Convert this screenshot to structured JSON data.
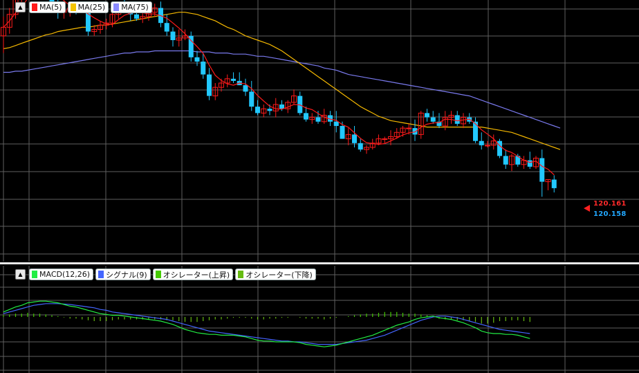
{
  "main_legend": {
    "collapse": "▲",
    "items": [
      {
        "label": "MA(5)",
        "color": "#ff1a1a"
      },
      {
        "label": "MA(25)",
        "color": "#f5c400"
      },
      {
        "label": "MA(75)",
        "color": "#8a8aff"
      }
    ]
  },
  "macd_legend": {
    "collapse": "▲",
    "items": [
      {
        "label": "MACD(12,26)",
        "color": "#22ee44"
      },
      {
        "label": "シグナル(9)",
        "color": "#4466ff"
      },
      {
        "label": "オシレーター(上昇)",
        "color": "#44cc00"
      },
      {
        "label": "オシレーター(下降)",
        "color": "#66bb11"
      }
    ]
  },
  "price_labels": {
    "current_red": "120.161",
    "current_blue": "120.158"
  },
  "chart_data": [
    {
      "type": "candlestick",
      "colors": {
        "up": "#ff1a1a",
        "down": "#22c8ff",
        "ma5": "#ff1a1a",
        "ma25": "#f5b800",
        "ma75": "#7a7aee",
        "grid": "#606060"
      },
      "candles": [
        [
          0.2,
          1.1,
          -0.6,
          0.6
        ],
        [
          0.6,
          1.5,
          0.3,
          1.2
        ],
        [
          1.2,
          2.2,
          1.0,
          2.0
        ],
        [
          2.0,
          3.0,
          1.6,
          2.4
        ],
        [
          2.4,
          3.9,
          2.2,
          3.5
        ],
        [
          3.5,
          3.7,
          2.6,
          2.9
        ],
        [
          2.9,
          3.2,
          2.3,
          2.7
        ],
        [
          2.7,
          2.9,
          1.9,
          2.2
        ],
        [
          2.2,
          2.5,
          1.3,
          1.6
        ],
        [
          1.6,
          1.9,
          1.0,
          1.3
        ],
        [
          1.3,
          1.7,
          1.0,
          1.4
        ],
        [
          1.4,
          1.8,
          1.1,
          1.5
        ],
        [
          1.5,
          1.6,
          1.2,
          1.4
        ],
        [
          1.4,
          1.5,
          1.3,
          1.4
        ],
        [
          1.4,
          1.6,
          0.2,
          0.4
        ],
        [
          0.4,
          0.7,
          0.2,
          0.5
        ],
        [
          0.5,
          0.9,
          0.3,
          0.7
        ],
        [
          0.7,
          1.0,
          0.5,
          0.8
        ],
        [
          0.8,
          1.7,
          0.6,
          1.2
        ],
        [
          1.2,
          1.8,
          1.0,
          1.6
        ],
        [
          1.6,
          2.1,
          1.3,
          1.5
        ],
        [
          1.5,
          1.8,
          0.9,
          1.2
        ],
        [
          1.2,
          1.4,
          0.9,
          1.0
        ],
        [
          1.0,
          1.3,
          0.8,
          1.1
        ],
        [
          1.1,
          1.5,
          0.9,
          1.3
        ],
        [
          1.3,
          1.7,
          1.1,
          1.5
        ],
        [
          1.5,
          1.8,
          0.6,
          0.8
        ],
        [
          0.8,
          1.2,
          0.2,
          0.4
        ],
        [
          0.4,
          0.6,
          -0.3,
          0.0
        ],
        [
          0.0,
          0.5,
          -0.3,
          0.1
        ],
        [
          0.1,
          0.5,
          0.0,
          0.2
        ],
        [
          0.2,
          0.4,
          -1.0,
          -0.8
        ],
        [
          -0.8,
          -0.5,
          -1.2,
          -1.0
        ],
        [
          -1.0,
          -0.6,
          -1.8,
          -1.6
        ],
        [
          -1.6,
          -1.3,
          -2.8,
          -2.6
        ],
        [
          -2.6,
          -2.0,
          -2.8,
          -2.2
        ],
        [
          -2.2,
          -1.8,
          -2.4,
          -2.0
        ],
        [
          -2.0,
          -1.6,
          -2.2,
          -1.8
        ],
        [
          -1.8,
          -1.5,
          -2.0,
          -1.9
        ],
        [
          -1.9,
          -1.5,
          -2.1,
          -2.1
        ],
        [
          -2.1,
          -1.8,
          -2.6,
          -2.4
        ],
        [
          -2.4,
          -1.9,
          -3.3,
          -3.1
        ],
        [
          -3.1,
          -2.8,
          -3.5,
          -3.4
        ],
        [
          -3.4,
          -3.0,
          -3.6,
          -3.2
        ],
        [
          -3.2,
          -3.0,
          -3.5,
          -3.3
        ],
        [
          -3.3,
          -2.7,
          -3.6,
          -3.0
        ],
        [
          -3.0,
          -2.8,
          -3.3,
          -3.2
        ],
        [
          -3.2,
          -2.8,
          -3.4,
          -2.9
        ],
        [
          -2.9,
          -2.3,
          -3.0,
          -2.6
        ],
        [
          -2.6,
          -2.4,
          -3.5,
          -3.4
        ],
        [
          -3.4,
          -3.1,
          -3.8,
          -3.7
        ],
        [
          -3.7,
          -3.4,
          -3.9,
          -3.6
        ],
        [
          -3.6,
          -3.3,
          -3.9,
          -3.8
        ],
        [
          -3.8,
          -3.2,
          -3.9,
          -3.5
        ],
        [
          -3.5,
          -3.3,
          -4.0,
          -3.8
        ],
        [
          -3.8,
          -3.3,
          -4.3,
          -4.0
        ],
        [
          -4.0,
          -3.8,
          -4.6,
          -4.6
        ],
        [
          -4.6,
          -4.1,
          -4.9,
          -4.4
        ],
        [
          -4.4,
          -4.0,
          -5.0,
          -4.8
        ],
        [
          -4.8,
          -4.6,
          -5.2,
          -5.1
        ],
        [
          -5.1,
          -4.9,
          -5.3,
          -5.0
        ],
        [
          -5.0,
          -4.6,
          -5.1,
          -4.8
        ],
        [
          -4.8,
          -4.4,
          -4.9,
          -4.6
        ],
        [
          -4.6,
          -4.5,
          -4.8,
          -4.6
        ],
        [
          -4.6,
          -4.2,
          -4.9,
          -4.5
        ],
        [
          -4.5,
          -4.1,
          -4.6,
          -4.3
        ],
        [
          -4.3,
          -4.0,
          -4.5,
          -4.1
        ],
        [
          -4.1,
          -3.9,
          -4.4,
          -4.1
        ],
        [
          -4.1,
          -3.7,
          -4.7,
          -4.4
        ],
        [
          -4.4,
          -3.3,
          -4.6,
          -3.4
        ],
        [
          -3.4,
          -3.2,
          -3.8,
          -3.6
        ],
        [
          -3.6,
          -3.3,
          -3.9,
          -3.8
        ],
        [
          -3.8,
          -3.4,
          -4.1,
          -4.0
        ],
        [
          -4.0,
          -3.3,
          -4.2,
          -3.6
        ],
        [
          -3.6,
          -3.3,
          -3.9,
          -3.5
        ],
        [
          -3.5,
          -3.3,
          -4.0,
          -3.9
        ],
        [
          -3.9,
          -3.4,
          -4.1,
          -3.6
        ],
        [
          -3.6,
          -3.4,
          -3.9,
          -3.8
        ],
        [
          -3.8,
          -3.6,
          -4.8,
          -4.7
        ],
        [
          -4.7,
          -4.3,
          -5.1,
          -4.9
        ],
        [
          -4.9,
          -4.7,
          -5.0,
          -4.9
        ],
        [
          -4.9,
          -4.4,
          -5.1,
          -4.7
        ],
        [
          -4.7,
          -4.6,
          -5.5,
          -5.4
        ],
        [
          -5.4,
          -5.1,
          -6.0,
          -5.8
        ],
        [
          -5.8,
          -5.3,
          -6.1,
          -5.4
        ],
        [
          -5.4,
          -5.3,
          -5.9,
          -5.8
        ],
        [
          -5.8,
          -5.4,
          -6.0,
          -5.6
        ],
        [
          -5.6,
          -5.2,
          -6.0,
          -5.9
        ],
        [
          -5.9,
          -5.4,
          -6.0,
          -5.5
        ],
        [
          -5.5,
          -5.1,
          -7.3,
          -6.6
        ],
        [
          -6.6,
          -6.5,
          -7.0,
          -6.5
        ],
        [
          -6.5,
          -6.3,
          -7.1,
          -6.9
        ]
      ],
      "ma25": [
        -0.4,
        -0.35,
        -0.25,
        -0.15,
        -0.05,
        0.05,
        0.15,
        0.25,
        0.3,
        0.4,
        0.45,
        0.5,
        0.55,
        0.6,
        0.6,
        0.65,
        0.7,
        0.7,
        0.75,
        0.8,
        0.85,
        0.9,
        0.95,
        1.0,
        1.05,
        1.1,
        1.15,
        1.2,
        1.25,
        1.3,
        1.3,
        1.25,
        1.2,
        1.1,
        1.0,
        0.9,
        0.75,
        0.6,
        0.5,
        0.35,
        0.2,
        0.1,
        0.0,
        -0.1,
        -0.2,
        -0.35,
        -0.5,
        -0.7,
        -0.9,
        -1.1,
        -1.3,
        -1.5,
        -1.7,
        -1.9,
        -2.1,
        -2.3,
        -2.5,
        -2.7,
        -2.9,
        -3.1,
        -3.25,
        -3.4,
        -3.55,
        -3.65,
        -3.75,
        -3.8,
        -3.85,
        -3.9,
        -3.95,
        -4.0,
        -4.05,
        -4.05,
        -4.05,
        -4.05,
        -4.05,
        -4.05,
        -4.05,
        -4.05,
        -4.05,
        -4.05,
        -4.1,
        -4.15,
        -4.2,
        -4.25,
        -4.3,
        -4.4,
        -4.5,
        -4.6,
        -4.7,
        -4.8,
        -4.9,
        -5.0,
        -5.1
      ],
      "ma75": [
        -1.5,
        -1.5,
        -1.45,
        -1.45,
        -1.4,
        -1.35,
        -1.3,
        -1.25,
        -1.2,
        -1.15,
        -1.1,
        -1.05,
        -1.0,
        -0.95,
        -0.9,
        -0.85,
        -0.8,
        -0.75,
        -0.7,
        -0.65,
        -0.6,
        -0.6,
        -0.55,
        -0.55,
        -0.55,
        -0.5,
        -0.5,
        -0.5,
        -0.5,
        -0.5,
        -0.5,
        -0.5,
        -0.55,
        -0.55,
        -0.55,
        -0.6,
        -0.6,
        -0.6,
        -0.65,
        -0.65,
        -0.65,
        -0.7,
        -0.75,
        -0.75,
        -0.8,
        -0.85,
        -0.9,
        -0.95,
        -1.0,
        -1.05,
        -1.1,
        -1.15,
        -1.2,
        -1.3,
        -1.35,
        -1.4,
        -1.5,
        -1.6,
        -1.65,
        -1.7,
        -1.75,
        -1.8,
        -1.85,
        -1.9,
        -1.95,
        -2.0,
        -2.05,
        -2.1,
        -2.15,
        -2.2,
        -2.25,
        -2.3,
        -2.35,
        -2.4,
        -2.45,
        -2.5,
        -2.55,
        -2.6,
        -2.7,
        -2.8,
        -2.9,
        -3.0,
        -3.1,
        -3.2,
        -3.3,
        -3.4,
        -3.5,
        -3.6,
        -3.7,
        -3.8,
        -3.9,
        -4.0,
        -4.1
      ],
      "last": {
        "red": 120.161,
        "blue": 120.158
      }
    },
    {
      "type": "macd",
      "colors": {
        "macd": "#22ee44",
        "signal": "#4466ff",
        "hist_up": "#44cc00",
        "hist_down": "#66bb11"
      },
      "macd": [
        0.3,
        0.45,
        0.6,
        0.7,
        0.85,
        0.9,
        0.95,
        0.95,
        0.9,
        0.85,
        0.75,
        0.65,
        0.6,
        0.5,
        0.4,
        0.3,
        0.2,
        0.15,
        0.1,
        0.1,
        0.05,
        0.0,
        -0.05,
        -0.1,
        -0.15,
        -0.2,
        -0.25,
        -0.35,
        -0.45,
        -0.6,
        -0.75,
        -0.85,
        -0.95,
        -1.0,
        -1.05,
        -1.05,
        -1.1,
        -1.1,
        -1.1,
        -1.15,
        -1.2,
        -1.3,
        -1.4,
        -1.45,
        -1.45,
        -1.5,
        -1.5,
        -1.5,
        -1.5,
        -1.55,
        -1.65,
        -1.7,
        -1.75,
        -1.8,
        -1.75,
        -1.7,
        -1.6,
        -1.5,
        -1.4,
        -1.3,
        -1.2,
        -1.1,
        -0.95,
        -0.8,
        -0.65,
        -0.5,
        -0.4,
        -0.3,
        -0.15,
        -0.05,
        0.0,
        0.05,
        -0.05,
        -0.1,
        -0.15,
        -0.25,
        -0.35,
        -0.5,
        -0.65,
        -0.85,
        -0.95,
        -1.0,
        -1.0,
        -1.05,
        -1.05,
        -1.1,
        -1.2,
        -1.3
      ],
      "signal": [
        0.2,
        0.3,
        0.4,
        0.5,
        0.6,
        0.7,
        0.75,
        0.8,
        0.8,
        0.8,
        0.78,
        0.75,
        0.7,
        0.65,
        0.6,
        0.55,
        0.45,
        0.4,
        0.3,
        0.25,
        0.2,
        0.15,
        0.1,
        0.05,
        0.0,
        -0.05,
        -0.1,
        -0.15,
        -0.25,
        -0.35,
        -0.45,
        -0.55,
        -0.65,
        -0.75,
        -0.85,
        -0.9,
        -0.95,
        -1.0,
        -1.05,
        -1.1,
        -1.15,
        -1.2,
        -1.25,
        -1.3,
        -1.35,
        -1.4,
        -1.45,
        -1.45,
        -1.5,
        -1.5,
        -1.55,
        -1.6,
        -1.65,
        -1.65,
        -1.65,
        -1.65,
        -1.6,
        -1.55,
        -1.5,
        -1.45,
        -1.4,
        -1.3,
        -1.2,
        -1.1,
        -0.95,
        -0.8,
        -0.65,
        -0.5,
        -0.35,
        -0.2,
        -0.1,
        0.0,
        0.05,
        0.05,
        0.0,
        -0.05,
        -0.15,
        -0.25,
        -0.35,
        -0.45,
        -0.55,
        -0.65,
        -0.75,
        -0.8,
        -0.85,
        -0.9,
        -0.95,
        -1.0
      ],
      "hist": [
        0.1,
        0.15,
        0.2,
        0.2,
        0.25,
        0.2,
        0.2,
        0.15,
        0.1,
        0.05,
        -0.03,
        -0.1,
        -0.1,
        -0.15,
        -0.2,
        -0.25,
        -0.25,
        -0.25,
        -0.2,
        -0.15,
        -0.15,
        -0.15,
        -0.15,
        -0.15,
        -0.15,
        -0.15,
        -0.15,
        -0.2,
        -0.2,
        -0.25,
        -0.3,
        -0.3,
        -0.3,
        -0.25,
        -0.2,
        -0.15,
        -0.15,
        -0.1,
        -0.05,
        -0.05,
        -0.05,
        -0.1,
        -0.15,
        -0.15,
        -0.1,
        -0.1,
        -0.05,
        -0.05,
        0.0,
        -0.05,
        -0.1,
        -0.1,
        -0.1,
        -0.15,
        -0.1,
        -0.05,
        0.0,
        0.05,
        0.1,
        0.15,
        0.2,
        0.2,
        0.25,
        0.3,
        0.3,
        0.3,
        0.25,
        0.2,
        0.2,
        0.15,
        0.1,
        0.05,
        -0.1,
        -0.15,
        -0.15,
        -0.2,
        -0.2,
        -0.25,
        -0.3,
        -0.4,
        -0.4,
        -0.35,
        -0.25,
        -0.25,
        -0.2,
        -0.2,
        -0.25,
        -0.3
      ]
    }
  ]
}
